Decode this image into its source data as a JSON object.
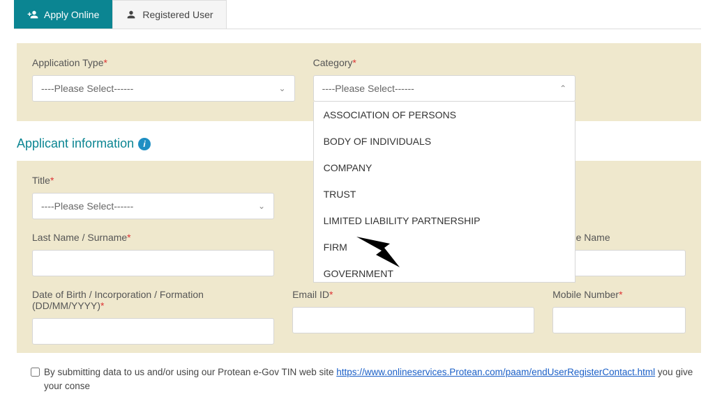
{
  "tabs": {
    "apply": "Apply Online",
    "registered": "Registered User"
  },
  "form": {
    "app_type_label": "Application Type",
    "category_label": "Category",
    "placeholder": "----Please Select------",
    "category_options": [
      "ASSOCIATION OF PERSONS",
      "BODY OF INDIVIDUALS",
      "COMPANY",
      "TRUST",
      "LIMITED LIABILITY PARTNERSHIP",
      "FIRM",
      "GOVERNMENT"
    ]
  },
  "section": {
    "title": "Applicant information"
  },
  "applicant": {
    "title_label": "Title",
    "last_name_label": "Last Name / Surname",
    "middle_name_label": "Middle Name",
    "dob_label": "Date of Birth / Incorporation / Formation (DD/MM/YYYY)",
    "email_label": "Email ID",
    "mobile_label": "Mobile Number"
  },
  "consent": {
    "pre": "By submitting data to us and/or using our Protean e-Gov TIN web site ",
    "link": "https://www.onlineservices.Protean.com/paam/endUserRegisterContact.html",
    "post": " you give your conse"
  }
}
